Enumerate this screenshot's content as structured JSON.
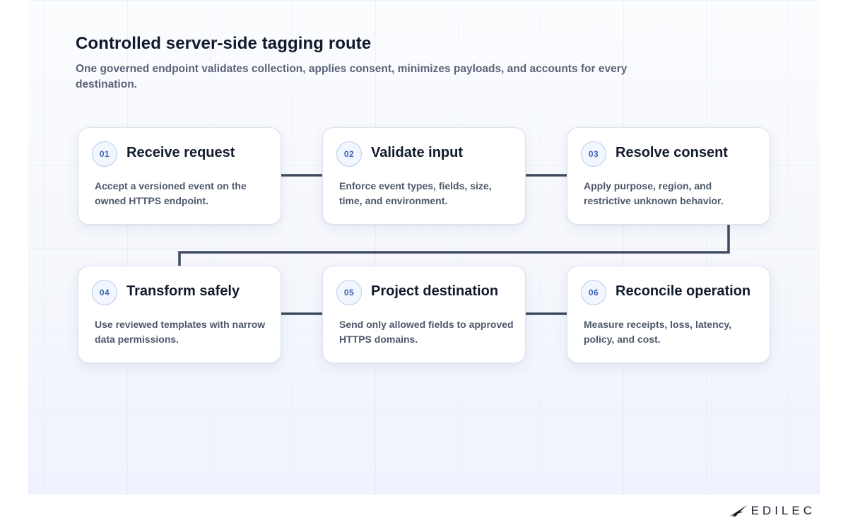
{
  "header": {
    "title": "Controlled server-side tagging route",
    "subtitle": "One governed endpoint validates collection, applies consent, minimizes payloads, and accounts for every destination."
  },
  "steps": [
    {
      "number": "01",
      "title": "Receive request",
      "description": "Accept a versioned event on the owned HTTPS endpoint."
    },
    {
      "number": "02",
      "title": "Validate input",
      "description": "Enforce event types, fields, size, time, and environment."
    },
    {
      "number": "03",
      "title": "Resolve consent",
      "description": "Apply purpose, region, and restrictive unknown behavior."
    },
    {
      "number": "04",
      "title": "Transform safely",
      "description": "Use reviewed templates with narrow data permissions."
    },
    {
      "number": "05",
      "title": "Project destination",
      "description": "Send only allowed fields to approved HTTPS domains."
    },
    {
      "number": "06",
      "title": "Reconcile operation",
      "description": "Measure receipts, loss, latency, policy, and cost."
    }
  ],
  "brand": {
    "name": "EDILEC",
    "icon": "edilec-logo-icon"
  },
  "colors": {
    "connector": "#3d4a5e",
    "badge_text": "#3b63b8",
    "badge_border": "#b9cbee"
  }
}
